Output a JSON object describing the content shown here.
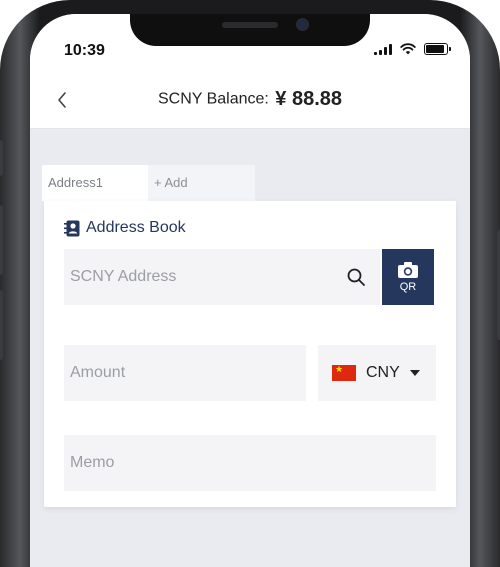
{
  "status_bar": {
    "time": "10:39"
  },
  "nav": {
    "title_label": "SCNY Balance:",
    "title_amount": "¥ 88.88"
  },
  "tabs": [
    {
      "label": "Address1",
      "active": true
    },
    {
      "label": "+ Add",
      "active": false
    }
  ],
  "form": {
    "address_book_label": "Address Book",
    "address_placeholder": "SCNY Address",
    "qr_label": "QR",
    "amount_placeholder": "Amount",
    "currency": {
      "code": "CNY",
      "flag": "china-flag"
    },
    "memo_placeholder": "Memo"
  },
  "colors": {
    "accent": "#26375e",
    "background": "#e9ebf1",
    "field": "#f4f4f6"
  }
}
